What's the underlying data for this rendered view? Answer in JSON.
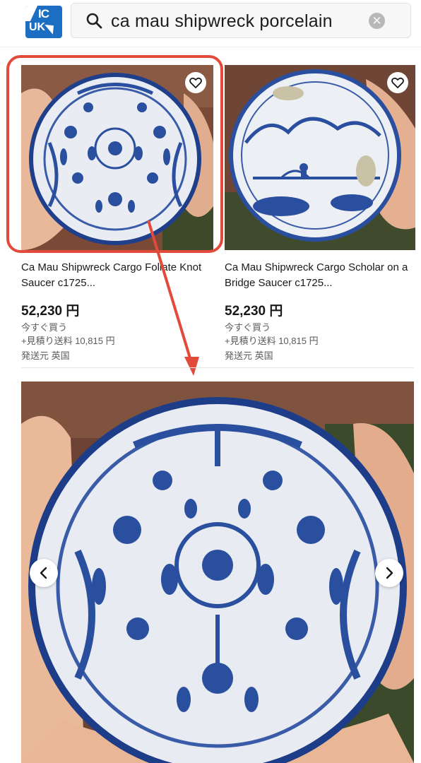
{
  "search": {
    "logo_top": "IC",
    "logo_bottom": "UK",
    "query": "ca mau shipwreck porcelain",
    "clear_symbol": "✕",
    "search_icon": "search-icon"
  },
  "listings": [
    {
      "title": "Ca Mau Shipwreck Cargo Foliate Knot Saucer c1725...",
      "price": "52,230 円",
      "buy_now": "今すぐ買う",
      "shipping": "+見積り送料 10,815 円",
      "ships_from": "発送元 英国",
      "favorite_icon": "heart-icon"
    },
    {
      "title": "Ca Mau Shipwreck Cargo Scholar on a Bridge Saucer c1725...",
      "price": "52,230 円",
      "buy_now": "今すぐ買う",
      "shipping": "+見積り送料 10,815 円",
      "ships_from": "発送元 英国",
      "favorite_icon": "heart-icon"
    }
  ],
  "gallery": {
    "prev_icon": "chevron-left-icon",
    "next_icon": "chevron-right-icon"
  },
  "colors": {
    "highlight": "#e24a3b",
    "logo": "#1b6ec2",
    "porcelain_blue": "#2a4f9e",
    "glaze": "#e8ecf2"
  }
}
